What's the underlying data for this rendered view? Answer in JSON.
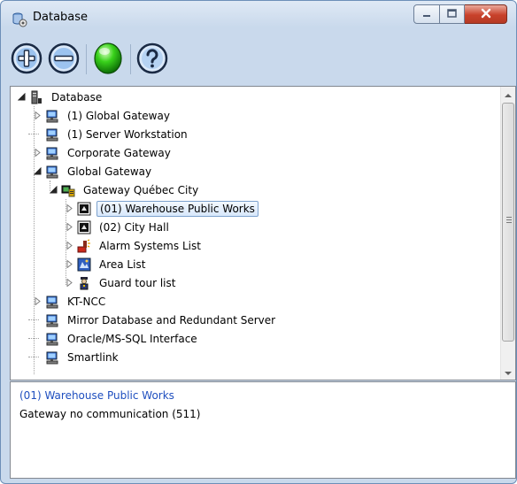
{
  "window": {
    "title": "Database",
    "title_icon": "database-app-icon",
    "controls": [
      "minimize-icon",
      "maximize-icon",
      "close-icon"
    ]
  },
  "toolbar": {
    "buttons": [
      {
        "name": "add-button",
        "icon": "plus-circle-icon"
      },
      {
        "name": "remove-button",
        "icon": "minus-circle-icon"
      },
      {
        "name": "status-button",
        "icon": "green-light-icon"
      },
      {
        "name": "help-button",
        "icon": "question-circle-icon"
      }
    ]
  },
  "tree": {
    "items": [
      {
        "label": "Database",
        "level": 0,
        "expand": "expanded",
        "icon": "database-icon"
      },
      {
        "label": "(1) Global Gateway",
        "level": 1,
        "expand": "collapsed",
        "icon": "gateway-computer-icon"
      },
      {
        "label": "(1) Server Workstation",
        "level": 1,
        "expand": "none",
        "icon": "gateway-computer-icon"
      },
      {
        "label": "Corporate Gateway",
        "level": 1,
        "expand": "collapsed",
        "icon": "gateway-computer-icon"
      },
      {
        "label": "Global Gateway",
        "level": 1,
        "expand": "expanded",
        "icon": "gateway-computer-icon"
      },
      {
        "label": "Gateway Québec City",
        "level": 2,
        "expand": "expanded",
        "icon": "gateway-site-icon"
      },
      {
        "label": "(01) Warehouse Public Works",
        "level": 3,
        "expand": "collapsed",
        "icon": "controller-icon",
        "selected": true
      },
      {
        "label": "(02) City Hall",
        "level": 3,
        "expand": "collapsed",
        "icon": "controller-icon"
      },
      {
        "label": "Alarm Systems List",
        "level": 3,
        "expand": "collapsed",
        "icon": "alarm-icon"
      },
      {
        "label": "Area List",
        "level": 3,
        "expand": "collapsed",
        "icon": "area-icon"
      },
      {
        "label": "Guard tour list",
        "level": 3,
        "expand": "collapsed",
        "icon": "guard-icon"
      },
      {
        "label": "KT-NCC",
        "level": 1,
        "expand": "collapsed",
        "icon": "gateway-computer-icon"
      },
      {
        "label": "Mirror Database and Redundant Server",
        "level": 1,
        "expand": "none",
        "icon": "gateway-computer-icon"
      },
      {
        "label": "Oracle/MS-SQL Interface",
        "level": 1,
        "expand": "none",
        "icon": "gateway-computer-icon"
      },
      {
        "label": "Smartlink",
        "level": 1,
        "expand": "none",
        "icon": "gateway-computer-icon"
      }
    ]
  },
  "info": {
    "title": "(01) Warehouse Public Works",
    "status": "Gateway no communication (511)"
  },
  "colors": {
    "selection_border": "#7da2ce",
    "info_title": "#1f4fbf",
    "close_button": "#c8412b"
  }
}
